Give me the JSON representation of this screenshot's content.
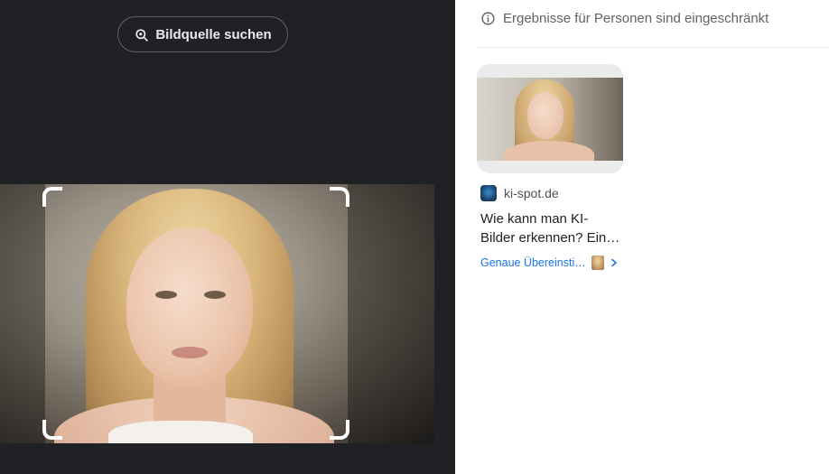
{
  "left": {
    "source_button_label": "Bildquelle suchen"
  },
  "right": {
    "notice_text": "Ergebnisse für Personen sind eingeschränkt",
    "result": {
      "site": "ki-spot.de",
      "title_line1": "Wie kann man KI-",
      "title_line2": "Bilder erkennen? Ein…",
      "match_label": "Genaue Übereinsti…"
    }
  },
  "colors": {
    "dark_bg": "#202124",
    "link_blue": "#1a73e8",
    "text_gray": "#5f6368"
  },
  "icons": {
    "source_button": "lens-search-icon",
    "notice": "info-icon",
    "favicon": "globe-favicon-icon",
    "match": "chevron-right-icon"
  }
}
